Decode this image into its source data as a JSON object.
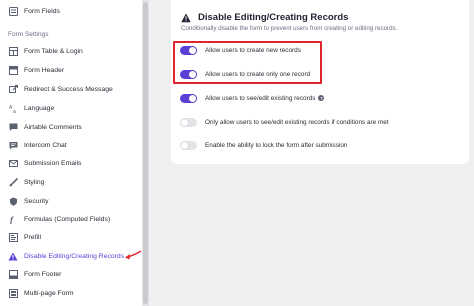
{
  "sidebar": {
    "top_item": "Form Fields",
    "section_label": "Form Settings",
    "items": [
      {
        "label": "Form Table & Login",
        "icon": "table-icon"
      },
      {
        "label": "Form Header",
        "icon": "header-icon"
      },
      {
        "label": "Redirect & Success Message",
        "icon": "redirect-icon"
      },
      {
        "label": "Language",
        "icon": "translate-icon"
      },
      {
        "label": "Airtable Comments",
        "icon": "comments-icon"
      },
      {
        "label": "Intercom Chat",
        "icon": "chat-icon"
      },
      {
        "label": "Submission Emails",
        "icon": "email-icon"
      },
      {
        "label": "Styling",
        "icon": "brush-icon"
      },
      {
        "label": "Security",
        "icon": "shield-icon"
      },
      {
        "label": "Formulas (Computed Fields)",
        "icon": "function-icon"
      },
      {
        "label": "Prefill",
        "icon": "prefill-icon"
      },
      {
        "label": "Disable Editing/Creating Records",
        "icon": "warning-icon",
        "active": true
      },
      {
        "label": "Form Footer",
        "icon": "footer-icon"
      },
      {
        "label": "Multi-page Form",
        "icon": "pages-icon"
      }
    ]
  },
  "panel": {
    "title": "Disable Editing/Creating Records",
    "subtitle": "Conditionally disable the form to prevent users from creating or editing records.",
    "options": [
      {
        "label": "Allow users to create new records",
        "on": true
      },
      {
        "label": "Allow users to create only one record",
        "on": true
      },
      {
        "label": "Allow users to see/edit existing records",
        "on": true,
        "help": true
      },
      {
        "label": "Only allow users to see/edit existing records if conditions are met",
        "on": false
      },
      {
        "label": "Enable the ability to lock the form after submission",
        "on": false
      }
    ]
  },
  "colors": {
    "accent": "#5b3fd6",
    "highlight_border": "#e0242b",
    "toggle_off": "#e3e4e8"
  }
}
